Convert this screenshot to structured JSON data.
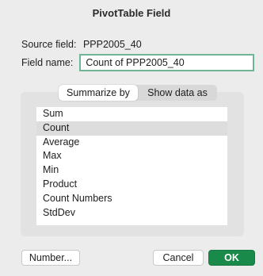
{
  "window": {
    "title": "PivotTable Field"
  },
  "source_field": {
    "label": "Source field:",
    "value": "PPP2005_40"
  },
  "field_name": {
    "label": "Field name:",
    "value": "Count of PPP2005_40"
  },
  "tabs": [
    {
      "label": "Summarize by",
      "active": true
    },
    {
      "label": "Show data as",
      "active": false
    }
  ],
  "summary_list": {
    "selected": "Count",
    "items": [
      "Sum",
      "Count",
      "Average",
      "Max",
      "Min",
      "Product",
      "Count Numbers",
      "StdDev"
    ]
  },
  "buttons": {
    "number": "Number...",
    "cancel": "Cancel",
    "ok": "OK"
  },
  "colors": {
    "ok_button": "#1a8a4a",
    "field_focus_ring": "#6fb494"
  }
}
